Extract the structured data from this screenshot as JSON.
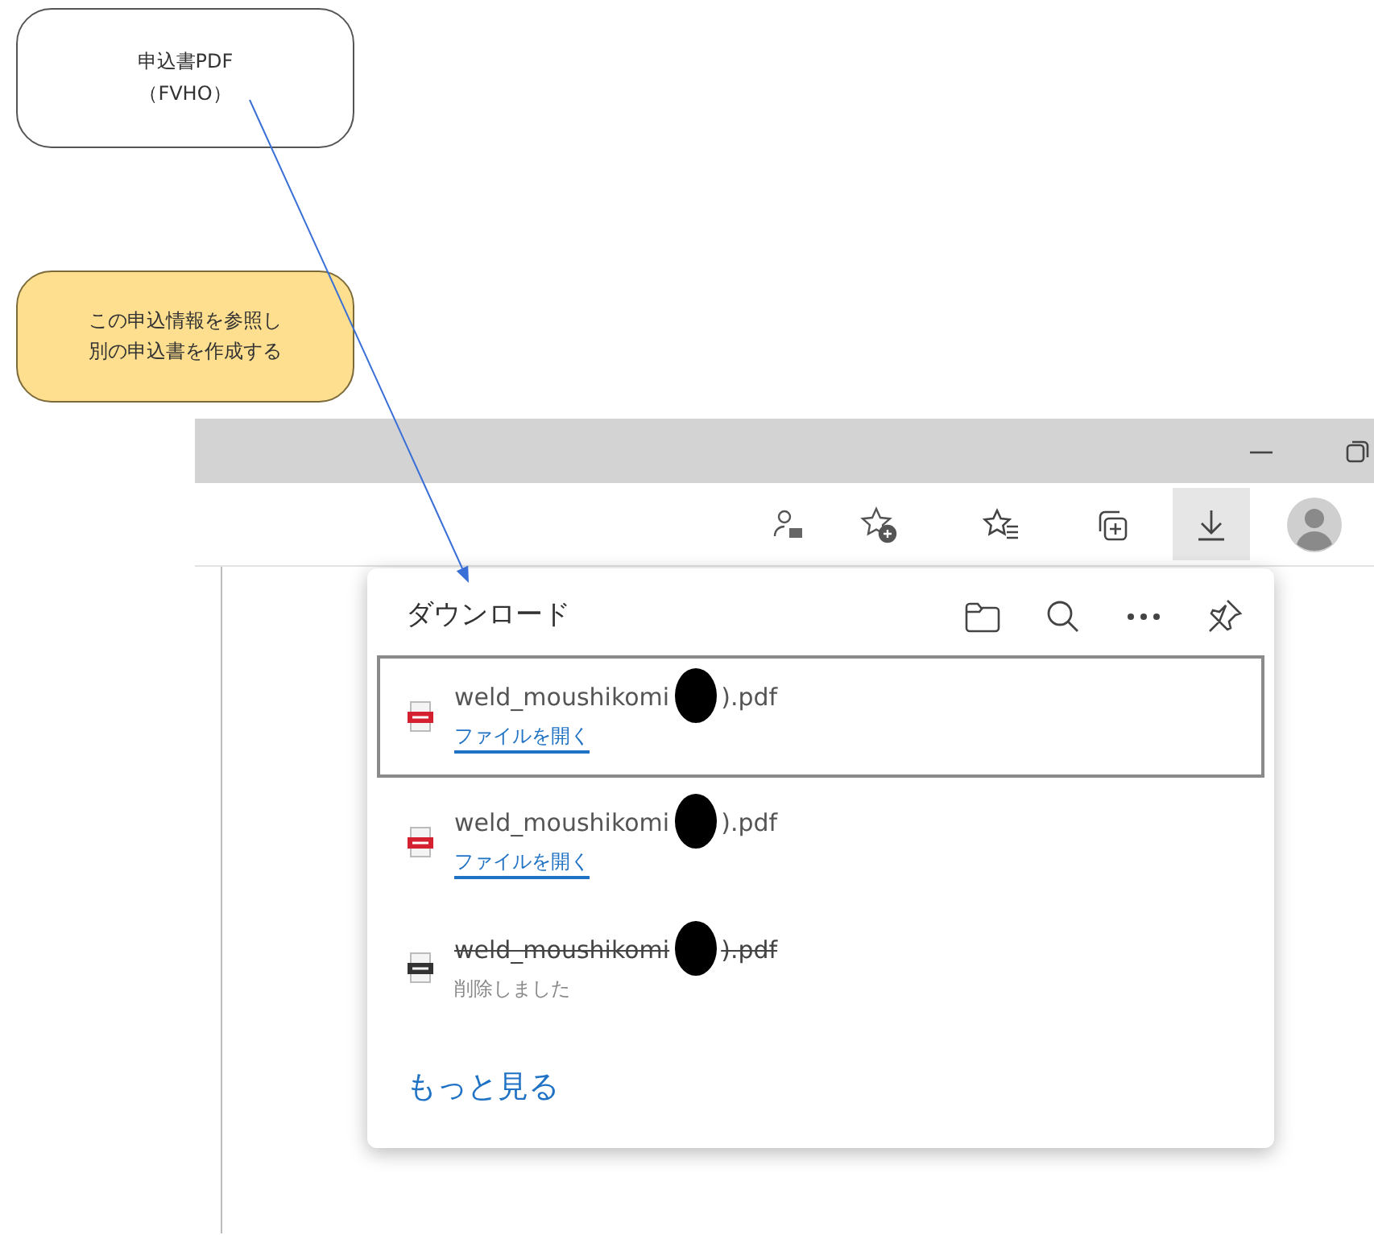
{
  "callouts": [
    {
      "kind": "plain",
      "lines": [
        "申込書PDF",
        "（FVHO）"
      ]
    },
    {
      "kind": "highlight",
      "lines": [
        "この申込情報を参照し",
        "別の申込書を作成する"
      ]
    }
  ],
  "toolbar": {
    "buttons": [
      {
        "kind": "profile-lock",
        "selected": false
      },
      {
        "kind": "favorite-add",
        "selected": false
      },
      {
        "kind": "favorites",
        "selected": false
      },
      {
        "kind": "collections",
        "selected": false
      },
      {
        "kind": "downloads",
        "selected": true
      },
      {
        "kind": "avatar",
        "selected": false
      }
    ]
  },
  "downloads": {
    "title": "ダウンロード",
    "items": [
      {
        "name_start": "weld_moushikomi",
        "name_end": ").pdf",
        "redacted": true,
        "status": "ファイルを開く",
        "deleted": false,
        "selected": true
      },
      {
        "name_start": "weld_moushikomi",
        "name_end": ").pdf",
        "redacted": true,
        "status": "ファイルを開く",
        "deleted": false,
        "selected": false
      },
      {
        "name_start": "weld_moushikomi",
        "name_end": ").pdf",
        "redacted": true,
        "status": "削除しました",
        "deleted": true,
        "selected": false
      }
    ],
    "more": "もっと見る"
  }
}
